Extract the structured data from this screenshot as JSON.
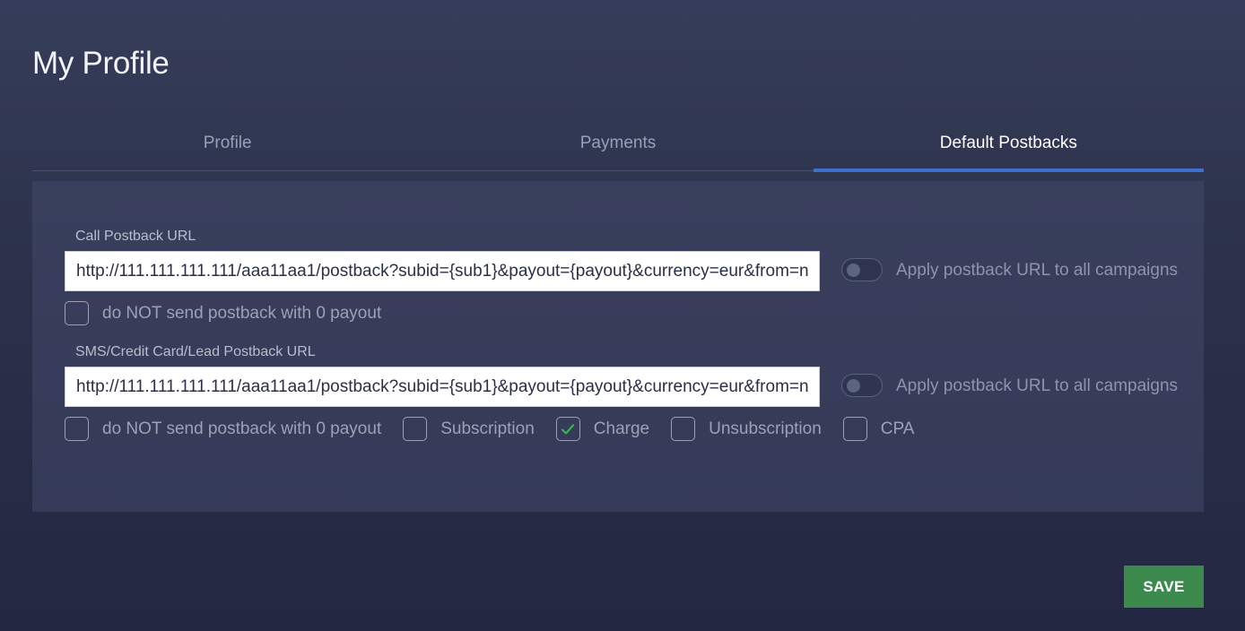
{
  "page": {
    "title": "My Profile"
  },
  "tabs": [
    {
      "label": "Profile",
      "active": false
    },
    {
      "label": "Payments",
      "active": false
    },
    {
      "label": "Default Postbacks",
      "active": true
    }
  ],
  "call_postback": {
    "label": "Call Postback URL",
    "url": "http://111.111.111.111/aaa11aa1/postback?subid={sub1}&payout={payout}&currency=eur&from=n",
    "apply_toggle_label": "Apply postback URL to all campaigns",
    "apply_toggle_on": false,
    "zero_payout": {
      "label": "do NOT send postback with 0 payout",
      "checked": false
    }
  },
  "sms_postback": {
    "label": "SMS/Credit Card/Lead Postback URL",
    "url": "http://111.111.111.111/aaa11aa1/postback?subid={sub1}&payout={payout}&currency=eur&from=n",
    "apply_toggle_label": "Apply postback URL to all campaigns",
    "apply_toggle_on": false,
    "options": [
      {
        "label": "do NOT send postback with 0 payout",
        "checked": false
      },
      {
        "label": "Subscription",
        "checked": false
      },
      {
        "label": "Charge",
        "checked": true
      },
      {
        "label": "Unsubscription",
        "checked": false
      },
      {
        "label": "CPA",
        "checked": false
      }
    ]
  },
  "actions": {
    "save_label": "SAVE"
  },
  "colors": {
    "accent": "#3f6fd0",
    "save": "#3d8a4f",
    "check": "#3fae5a"
  },
  "icons": [
    "check-icon"
  ]
}
